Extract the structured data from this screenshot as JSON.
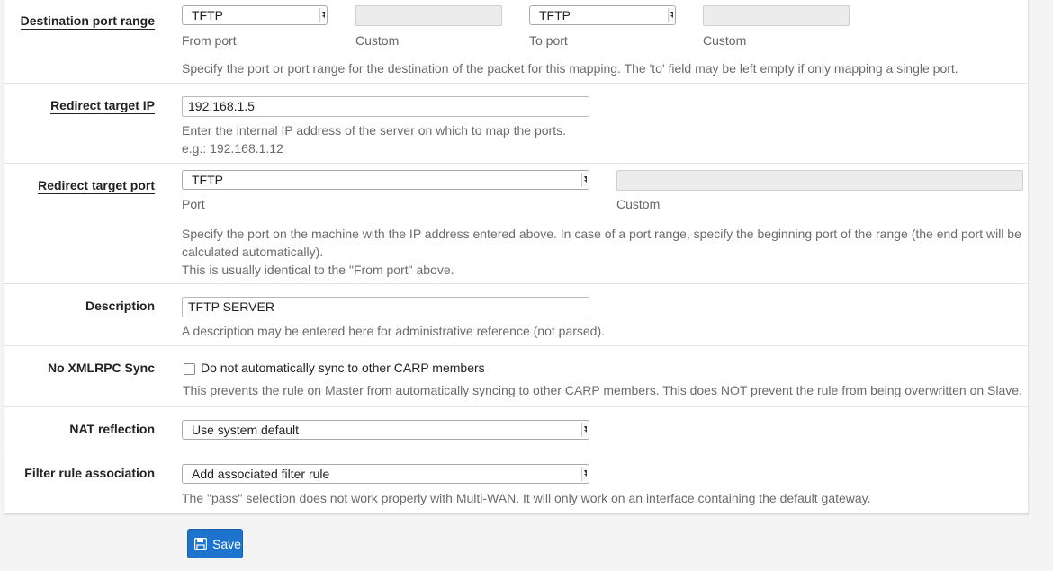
{
  "form": {
    "destination_port_range": {
      "label": "Destination port range",
      "from_port": {
        "selected": "TFTP",
        "sub": "From port"
      },
      "from_custom": {
        "value": "",
        "sub": "Custom"
      },
      "to_port": {
        "selected": "TFTP",
        "sub": "To port"
      },
      "to_custom": {
        "value": "",
        "sub": "Custom"
      },
      "help": "Specify the port or port range for the destination of the packet for this mapping. The 'to' field may be left empty if only mapping a single port."
    },
    "redirect_target_ip": {
      "label": "Redirect target IP",
      "value": "192.168.1.5",
      "help_line1": "Enter the internal IP address of the server on which to map the ports.",
      "help_line2": "e.g.: 192.168.1.12"
    },
    "redirect_target_port": {
      "label": "Redirect target port",
      "port": {
        "selected": "TFTP",
        "sub": "Port"
      },
      "custom": {
        "value": "",
        "sub": "Custom"
      },
      "help_line1": "Specify the port on the machine with the IP address entered above. In case of a port range, specify the beginning port of the range (the end port will be",
      "help_line2": "calculated automatically).",
      "help_line3": "This is usually identical to the \"From port\" above."
    },
    "description": {
      "label": "Description",
      "value": "TFTP SERVER",
      "help": "A description may be entered here for administrative reference (not parsed)."
    },
    "no_xmlrpc_sync": {
      "label": "No XMLRPC Sync",
      "checked": false,
      "checkbox_label": "Do not automatically sync to other CARP members",
      "help": "This prevents the rule on Master from automatically syncing to other CARP members. This does NOT prevent the rule from being overwritten on Slave."
    },
    "nat_reflection": {
      "label": "NAT reflection",
      "selected": "Use system default"
    },
    "filter_rule_association": {
      "label": "Filter rule association",
      "selected": "Add associated filter rule",
      "help": "The \"pass\" selection does not work properly with Multi-WAN. It will only work on an interface containing the default gateway."
    }
  },
  "actions": {
    "save_label": "Save",
    "save_icon": "floppy-disk-icon",
    "accent": "#1e74cc"
  }
}
